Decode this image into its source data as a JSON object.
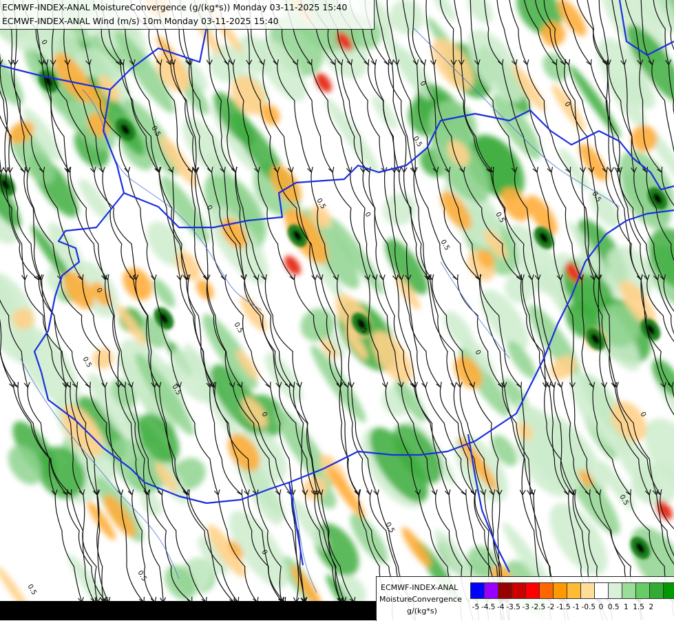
{
  "title": {
    "line1": "ECMWF-INDEX-ANAL MoistureConvergence (g/(kg*s)) Monday 03-11-2025 15:40",
    "line2": "ECMWF-INDEX-ANAL Wind (m/s) 10m Monday 03-11-2025 15:40"
  },
  "legend": {
    "model": "ECMWF-INDEX-ANAL",
    "parameter": "MoistureConvergence",
    "unit": "g/(kg*s)",
    "colors": [
      "#0000ff",
      "#9900ff",
      "#990000",
      "#cc0000",
      "#ff0000",
      "#ff6600",
      "#ff9900",
      "#ffbb33",
      "#ffdd99",
      "#ffffff",
      "#d9f0d9",
      "#99dd99",
      "#66cc66",
      "#33aa33",
      "#009900"
    ],
    "ticks": [
      "-5",
      "-4.5",
      "-4",
      "-3.5",
      "-3",
      "-2.5",
      "-2",
      "-1.5",
      "-1",
      "-0.5",
      "0",
      "0.5",
      "1",
      "1.5",
      "2"
    ]
  },
  "map": {
    "contour_labels": [
      "0",
      "0.5",
      "0",
      "0.5",
      "0",
      "0.5",
      "0",
      "0.5",
      "0.5",
      "0",
      "0.5",
      "0",
      "0.5",
      "0.5",
      "0",
      "0.5",
      "0",
      "0.5",
      "0.5",
      "0",
      "0.5",
      "0.5",
      "0",
      "0.5"
    ],
    "colors": {
      "border": "#1a2ee0",
      "river": "#4a6fd8",
      "streamline": "#111111",
      "green_light": "#cdeccd",
      "green_mid": "#8fd48f",
      "green_dark": "#3fae3f",
      "orange_light": "#ffd28a",
      "orange_mid": "#ffae3b",
      "red": "#e8301c"
    },
    "icons": [
      "streamline-arrow",
      "contour-label"
    ]
  }
}
